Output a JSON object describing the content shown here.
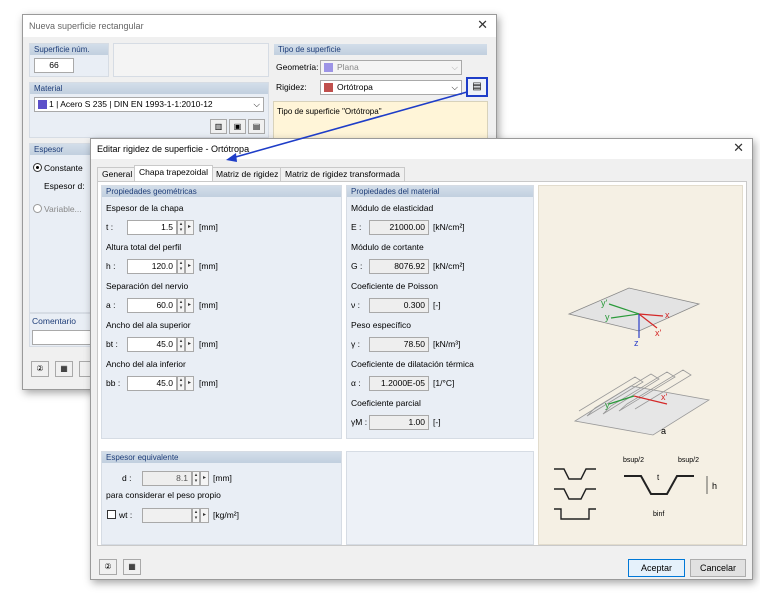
{
  "bg_dialog": {
    "title": "Nueva superficie rectangular",
    "surface_no_label": "Superficie núm.",
    "surface_no_value": "66",
    "surface_type_label": "Tipo de superficie",
    "geometry_label": "Geometría:",
    "geometry_value": "Plana",
    "stiffness_label": "Rigidez:",
    "stiffness_value": "Ortótropa",
    "material_label": "Material",
    "material_value": "1 | Acero S 235 | DIN EN 1993-1-1:2010-12",
    "info_text": "Tipo de superficie \"Ortótropa\"",
    "thickness_label": "Espesor",
    "constant_label": "Constante",
    "thickness_d_label": "Espesor d:",
    "variable_label": "Variable...",
    "comment_label": "Comentario"
  },
  "dialog": {
    "title": "Editar rigidez de superficie - Ortótropa",
    "tabs": [
      "General",
      "Chapa trapezoidal",
      "Matriz de rigidez",
      "Matriz de rigidez transformada"
    ],
    "geo_group_title": "Propiedades geométricas",
    "geo_fields": [
      {
        "label": "Espesor de la chapa",
        "sym": "t :",
        "value": "1.5",
        "unit": "[mm]"
      },
      {
        "label": "Altura total del perfil",
        "sym": "h :",
        "value": "120.0",
        "unit": "[mm]"
      },
      {
        "label": "Separación del nervio",
        "sym": "a :",
        "value": "60.0",
        "unit": "[mm]"
      },
      {
        "label": "Ancho del ala superior",
        "sym": "bt :",
        "value": "45.0",
        "unit": "[mm]"
      },
      {
        "label": "Ancho del ala inferior",
        "sym": "bb :",
        "value": "45.0",
        "unit": "[mm]"
      }
    ],
    "mat_group_title": "Propiedades del material",
    "mat_fields": [
      {
        "label": "Módulo de elasticidad",
        "sym": "E :",
        "value": "21000.00",
        "unit": "[kN/cm²]"
      },
      {
        "label": "Módulo de cortante",
        "sym": "G :",
        "value": "8076.92",
        "unit": "[kN/cm²]"
      },
      {
        "label": "Coeficiente de Poisson",
        "sym": "ν :",
        "value": "0.300",
        "unit": "[-]"
      },
      {
        "label": "Peso específico",
        "sym": "γ :",
        "value": "78.50",
        "unit": "[kN/m³]"
      },
      {
        "label": "Coeficiente de dilatación térmica",
        "sym": "α :",
        "value": "1.2000E-05",
        "unit": "[1/°C]"
      },
      {
        "label": "Coeficiente parcial",
        "sym": "γM :",
        "value": "1.00",
        "unit": "[-]"
      }
    ],
    "eq_group_title": "Espesor equivalente",
    "eq_d_sym": "d :",
    "eq_d_value": "8.1",
    "eq_d_unit": "[mm]",
    "eq_note": "para considerar el peso propio",
    "wt_label": "wt :",
    "wt_unit": "[kg/m²]",
    "accept_label": "Aceptar",
    "cancel_label": "Cancelar",
    "diagram": {
      "axis_y1": "y'",
      "axis_y": "y",
      "axis_x": "x",
      "axis_x1": "x'",
      "axis_z": "z",
      "axis_a": "a",
      "lbl_bsup1": "bsup/2",
      "lbl_bsup2": "bsup/2",
      "lbl_h": "h",
      "lbl_binf": "binf",
      "lbl_t": "t"
    }
  },
  "colors": {
    "stiffness_swatch": "#c0504d",
    "material_swatch": "#5b4fc9",
    "geometry_swatch": "#9d94e6",
    "group_header": "#c7d4e4",
    "accent_line": "#1e3dc8"
  }
}
